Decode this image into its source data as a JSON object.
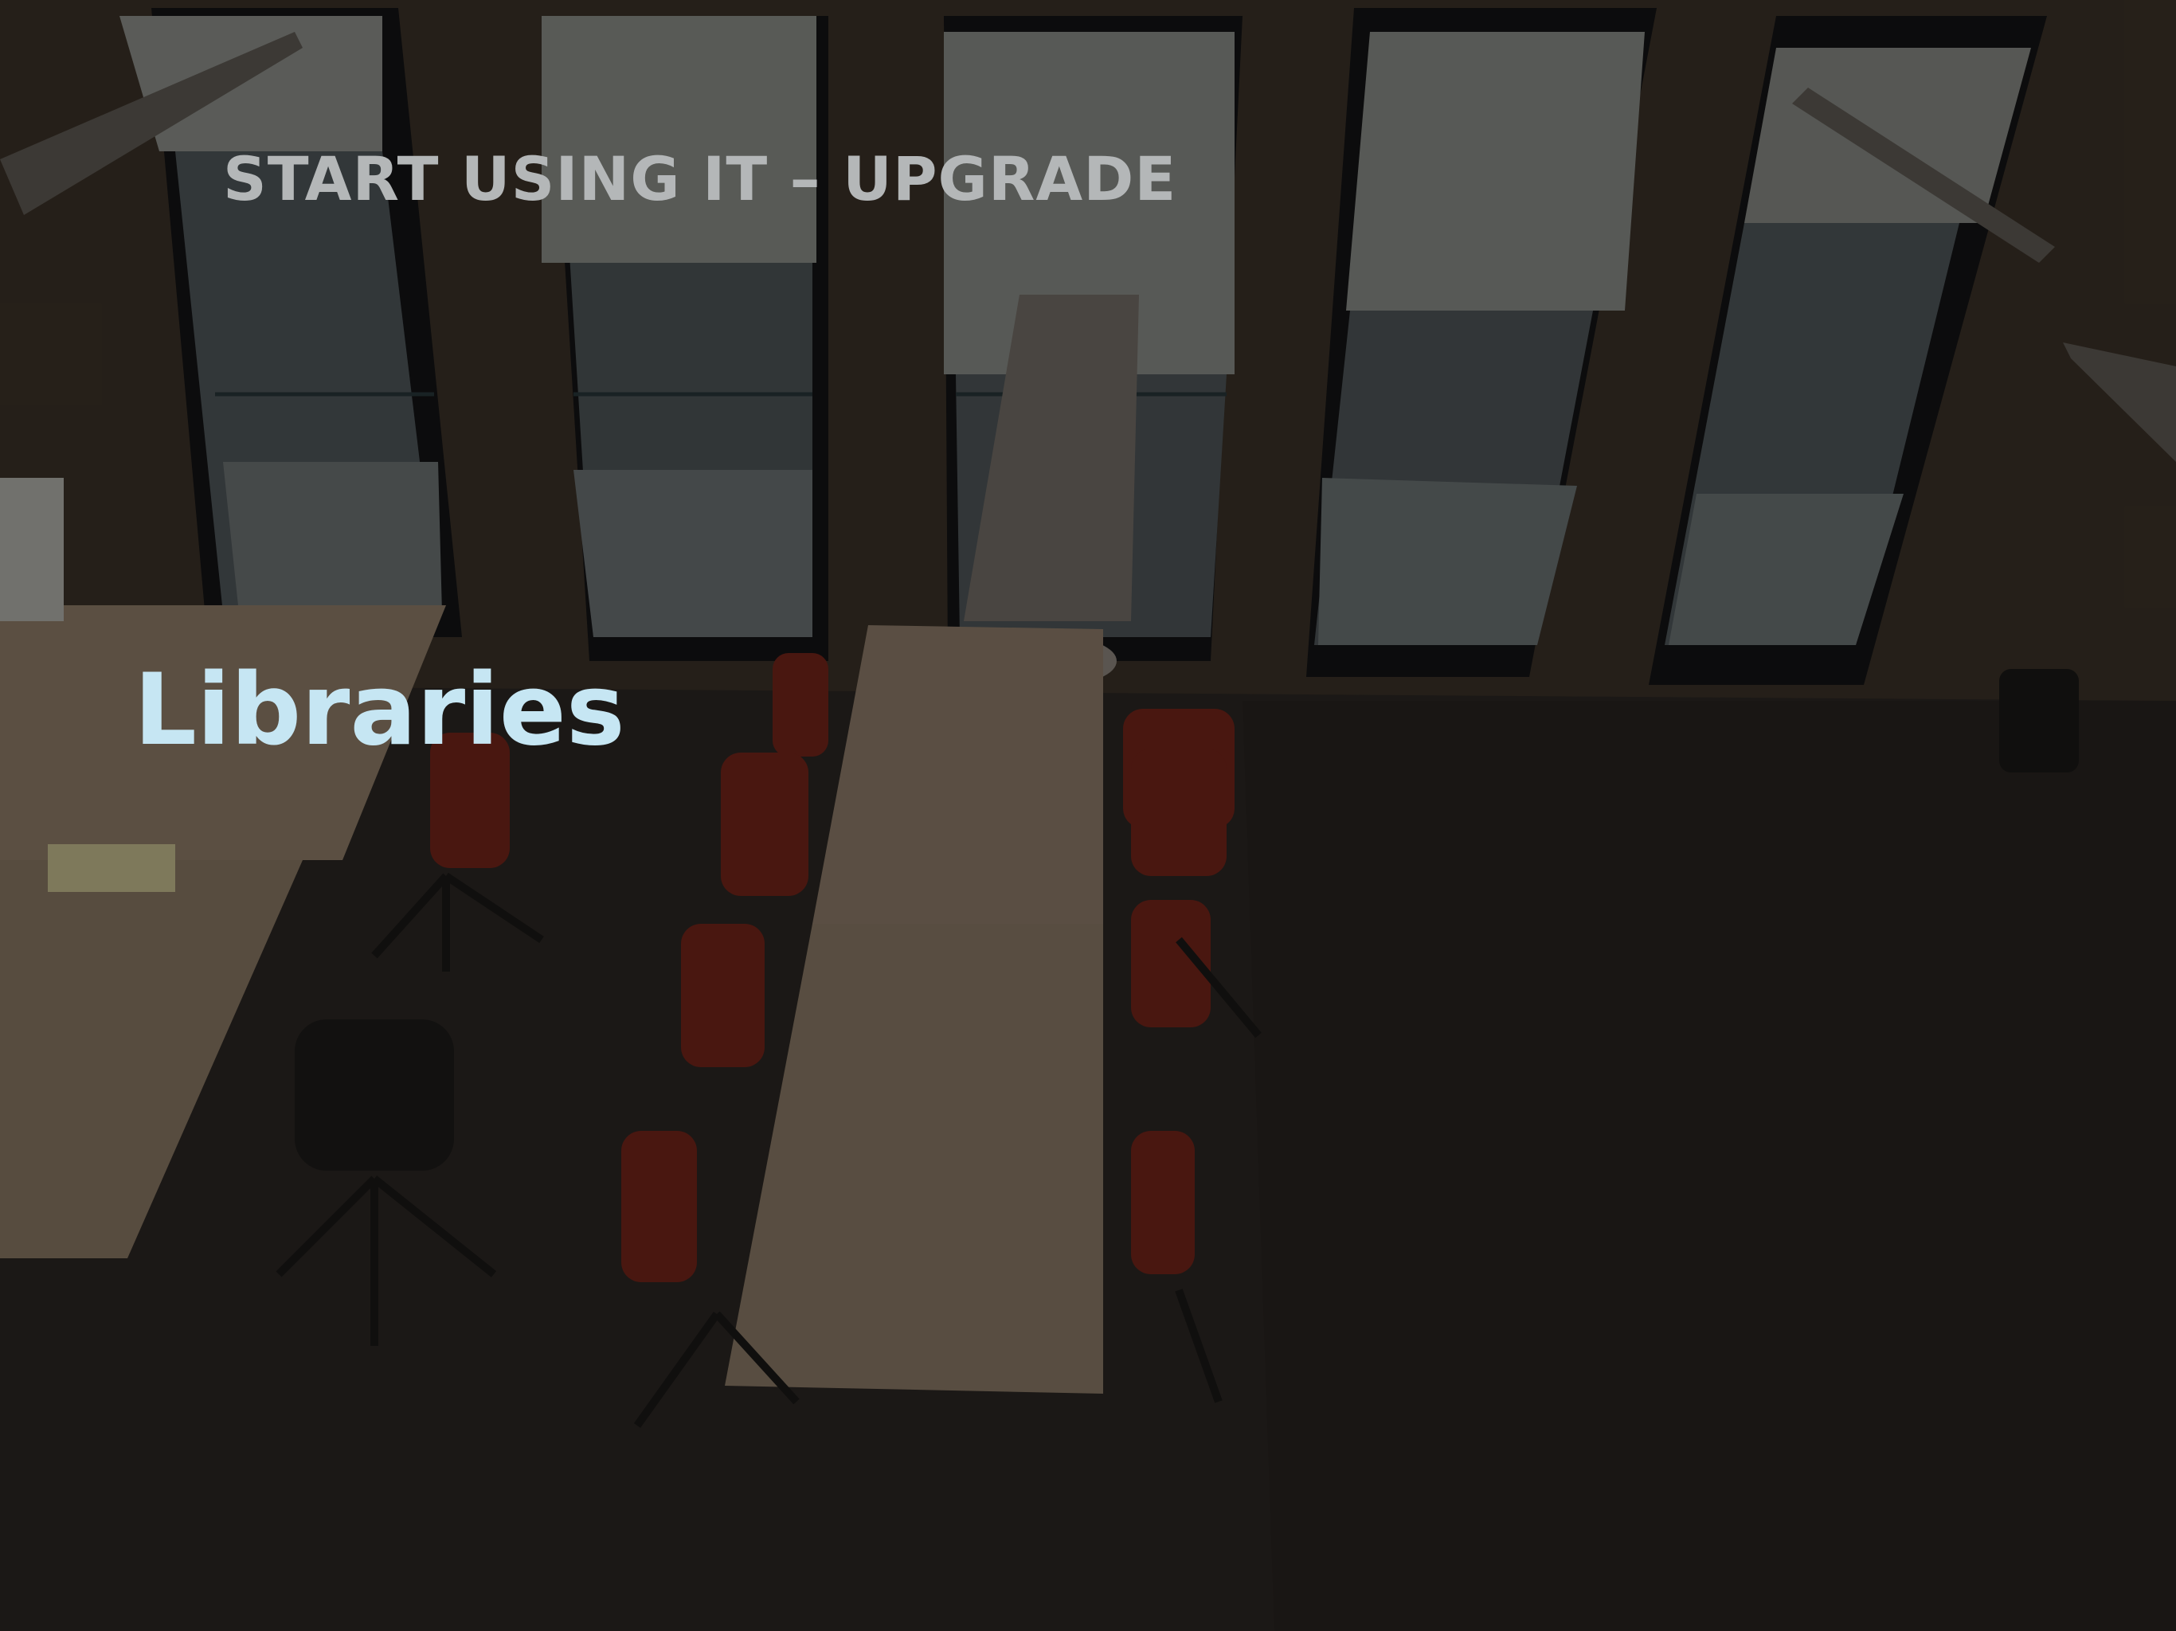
{
  "slide": {
    "kicker": "START USING IT – UPGRADE",
    "heading": "Libraries"
  },
  "colors": {
    "kicker": "#b4b7b8",
    "heading": "#c6e6f3",
    "background": "#231f1b"
  }
}
